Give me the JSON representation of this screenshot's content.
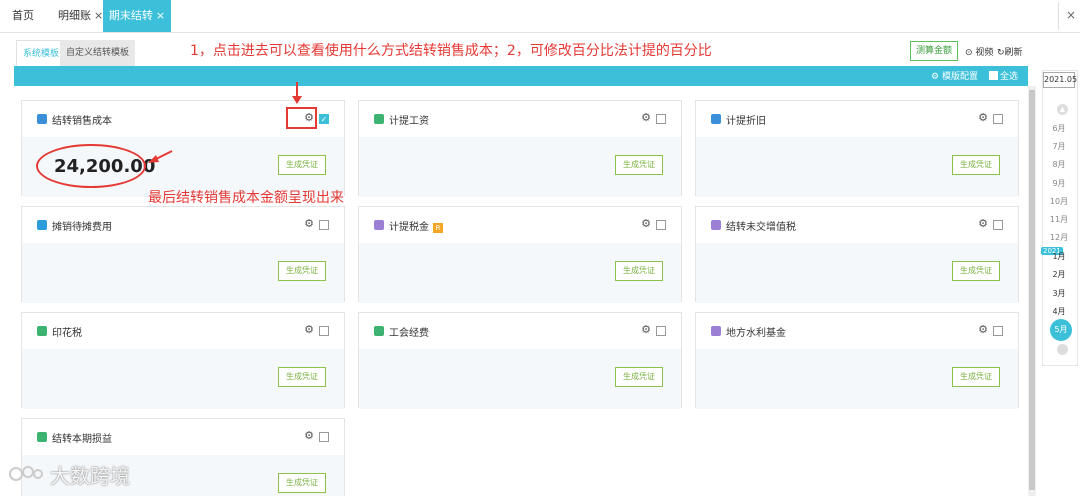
{
  "topbar": {
    "tabs": [
      {
        "label": "首页"
      },
      {
        "label": "明细账",
        "close": "×"
      },
      {
        "label": "期末结转",
        "close": "×"
      }
    ],
    "close_glyph": "×"
  },
  "subtabs": [
    "系统模板",
    "自定义结转模板"
  ],
  "annotations": {
    "top": "1，点击进去可以查看使用什么方式结转销售成本；2，可修改百分比法计提的百分比",
    "bottom": "最后结转销售成本金额呈现出来"
  },
  "toolbar": {
    "measure_label": "测算金额",
    "video_label": "视频",
    "refresh_label": "刷新"
  },
  "header_bar": {
    "template_config": "模版配置",
    "select_all": "全选"
  },
  "cards": [
    {
      "title": "结转销售成本",
      "icon": "money-bag-icon",
      "icon_color": "#3b8fd9",
      "checked": true,
      "amount": "24,200.00",
      "button": "生成凭证"
    },
    {
      "title": "计提工资",
      "icon": "salary-icon",
      "icon_color": "#3cb371",
      "checked": false,
      "button": "生成凭证"
    },
    {
      "title": "计提折旧",
      "icon": "depreciation-icon",
      "icon_color": "#3b8fd9",
      "checked": false,
      "button": "生成凭证"
    },
    {
      "title": "摊销待摊费用",
      "icon": "grid-icon",
      "icon_color": "#2d9cdb",
      "checked": false,
      "button": "生成凭证"
    },
    {
      "title": "计提税金",
      "icon": "tax-coins-icon",
      "icon_color": "#9b7fd4",
      "checked": false,
      "badge": "R",
      "button": "生成凭证"
    },
    {
      "title": "结转未交增值税",
      "icon": "vat-bag-icon",
      "icon_color": "#9b7fd4",
      "checked": false,
      "button": "生成凭证"
    },
    {
      "title": "印花税",
      "icon": "stamp-doc-icon",
      "icon_color": "#3cb371",
      "checked": false,
      "button": "生成凭证"
    },
    {
      "title": "工会经费",
      "icon": "union-fund-icon",
      "icon_color": "#3cb371",
      "checked": false,
      "button": "生成凭证"
    },
    {
      "title": "地方水利基金",
      "icon": "water-fund-icon",
      "icon_color": "#9b7fd4",
      "checked": false,
      "button": "生成凭证"
    },
    {
      "title": "结转本期损益",
      "icon": "profit-loss-icon",
      "icon_color": "#3cb371",
      "checked": false,
      "button": "生成凭证"
    }
  ],
  "month_picker": {
    "year": "2021.05",
    "year_tag": "2021",
    "months_prev": [
      "6月",
      "7月",
      "8月",
      "9月",
      "10月",
      "11月",
      "12月"
    ],
    "months_current": [
      "1月",
      "2月",
      "3月",
      "4月"
    ],
    "selected": "5月"
  },
  "watermark": "大数跨境"
}
